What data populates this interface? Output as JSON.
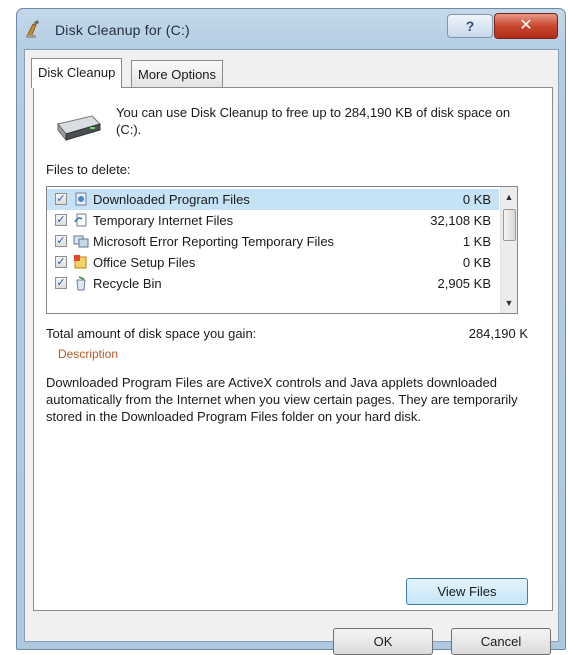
{
  "window": {
    "title": "Disk Cleanup for  (C:)",
    "help_label": "?",
    "close_label": "✕"
  },
  "tabs": [
    {
      "label": "Disk Cleanup",
      "active": true
    },
    {
      "label": "More Options",
      "active": false
    }
  ],
  "intro_text": "You can use Disk Cleanup to free up to 284,190 KB of disk space on  (C:).",
  "files_label": "Files to delete:",
  "files": [
    {
      "name": "Downloaded Program Files",
      "size": "0 KB",
      "checked": true,
      "selected": true,
      "icon": "program-files-icon"
    },
    {
      "name": "Temporary Internet Files",
      "size": "32,108 KB",
      "checked": true,
      "selected": false,
      "icon": "internet-files-icon"
    },
    {
      "name": "Microsoft Error Reporting Temporary Files",
      "size": "1 KB",
      "checked": true,
      "selected": false,
      "icon": "error-reporting-icon"
    },
    {
      "name": "Office Setup Files",
      "size": "0 KB",
      "checked": true,
      "selected": false,
      "icon": "office-setup-icon"
    },
    {
      "name": "Recycle Bin",
      "size": "2,905 KB",
      "checked": true,
      "selected": false,
      "icon": "recycle-bin-icon"
    }
  ],
  "total_label": "Total amount of disk space you gain:",
  "total_value": "284,190 K",
  "description": {
    "legend": "Description",
    "text": "Downloaded Program Files are ActiveX controls and Java applets downloaded automatically from the Internet when you view certain pages. They are temporarily stored in the Downloaded Program Files folder on your hard disk."
  },
  "buttons": {
    "view_files": "View Files",
    "ok": "OK",
    "cancel": "Cancel"
  },
  "colors": {
    "selection": "#c6e2f7",
    "description_legend": "#b25a2a",
    "close_button": "#c9472f"
  }
}
